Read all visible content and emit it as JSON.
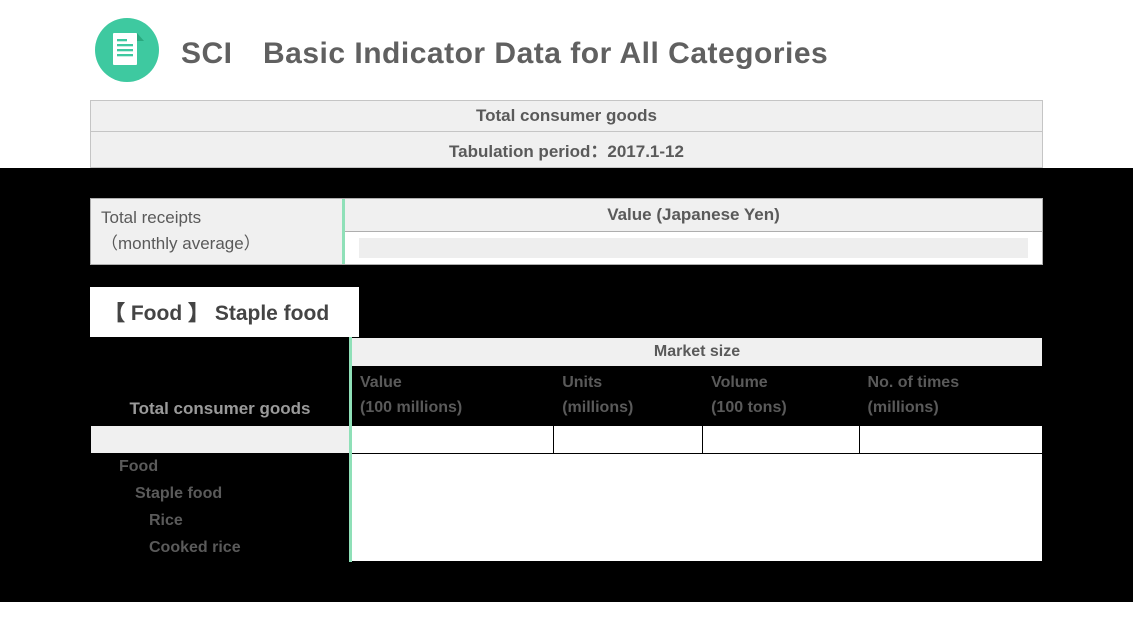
{
  "header": {
    "title": "SCI　Basic Indicator Data for All Categories"
  },
  "info": {
    "row1": "Total consumer goods",
    "row2": "Tabulation period：2017.1-12"
  },
  "receipts": {
    "line1": "Total receipts",
    "line2": "（monthly average）",
    "right_head": "Value (Japanese Yen)"
  },
  "tab": {
    "label": "【 Food 】 Staple food"
  },
  "market": {
    "cat_head": "Total consumer goods",
    "group_head": "Market size",
    "cols": [
      {
        "h1": "Value",
        "h2": "(100 millions)"
      },
      {
        "h1": "Units",
        "h2": "(millions)"
      },
      {
        "h1": "Volume",
        "h2": "(100 tons)"
      },
      {
        "h1": "No. of times",
        "h2": "(millions)"
      }
    ],
    "rows": [
      {
        "label": "Food",
        "indent": "indent1"
      },
      {
        "label": "Staple food",
        "indent": "indent2"
      },
      {
        "label": "Rice",
        "indent": "indent3"
      },
      {
        "label": "Cooked rice",
        "indent": "indent3"
      }
    ]
  }
}
